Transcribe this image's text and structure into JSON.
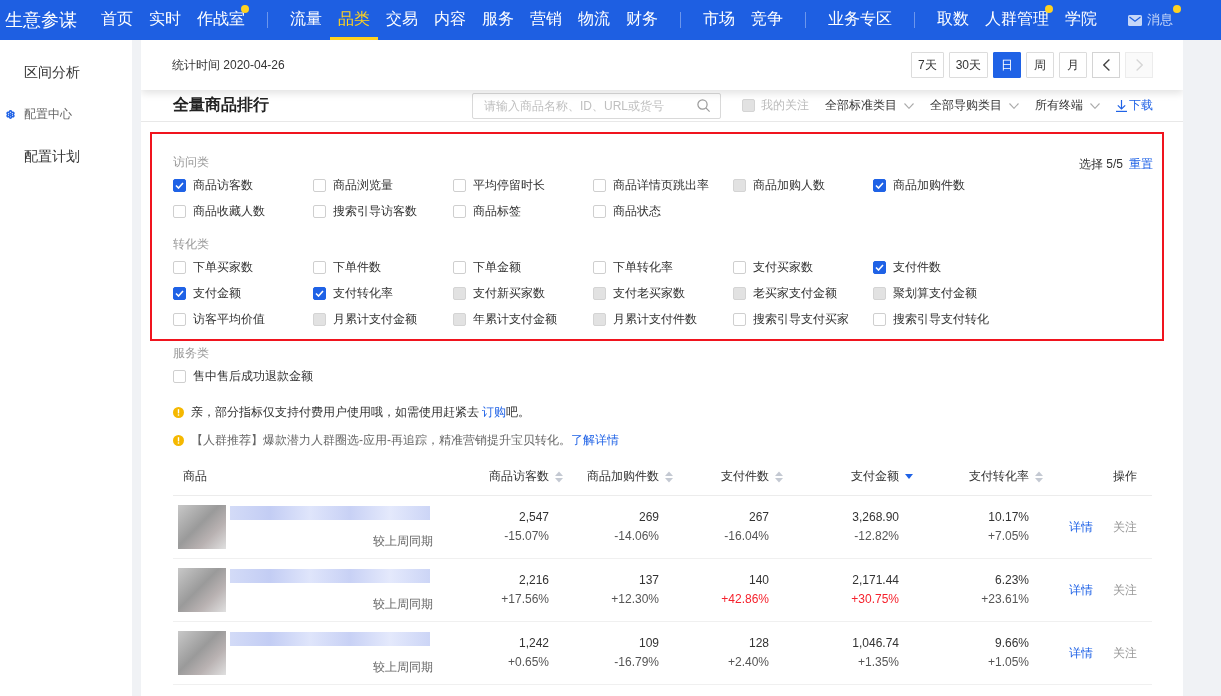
{
  "top_nav": {
    "brand": "生意参谋",
    "groups": [
      {
        "items": [
          {
            "label": "首页",
            "selected": false,
            "dot": false
          },
          {
            "label": "实时",
            "selected": false,
            "dot": false
          },
          {
            "label": "作战室",
            "selected": false,
            "dot": true
          }
        ]
      },
      {
        "items": [
          {
            "label": "流量",
            "selected": false,
            "dot": false
          },
          {
            "label": "品类",
            "selected": true,
            "dot": false
          },
          {
            "label": "交易",
            "selected": false,
            "dot": false
          },
          {
            "label": "内容",
            "selected": false,
            "dot": false
          },
          {
            "label": "服务",
            "selected": false,
            "dot": false
          },
          {
            "label": "营销",
            "selected": false,
            "dot": false
          },
          {
            "label": "物流",
            "selected": false,
            "dot": false
          },
          {
            "label": "财务",
            "selected": false,
            "dot": false
          }
        ]
      },
      {
        "items": [
          {
            "label": "市场",
            "selected": false,
            "dot": false
          },
          {
            "label": "竞争",
            "selected": false,
            "dot": false
          }
        ]
      },
      {
        "items": [
          {
            "label": "业务专区",
            "selected": false,
            "dot": false
          }
        ]
      },
      {
        "items": [
          {
            "label": "取数",
            "selected": false,
            "dot": false
          },
          {
            "label": "人群管理",
            "selected": false,
            "dot": true
          },
          {
            "label": "学院",
            "selected": false,
            "dot": false
          }
        ]
      }
    ],
    "messages": {
      "label": "消息",
      "dot": true
    }
  },
  "sidebar": {
    "items": [
      {
        "kind": "link",
        "label": "区间分析"
      },
      {
        "kind": "section",
        "label": "配置中心"
      },
      {
        "kind": "link",
        "label": "配置计划"
      }
    ]
  },
  "header": {
    "stat_time": "统计时间 2020-04-26",
    "periods": [
      {
        "label": "7天",
        "selected": false
      },
      {
        "label": "30天",
        "selected": false
      },
      {
        "label": "日",
        "selected": true
      },
      {
        "label": "周",
        "selected": false
      },
      {
        "label": "月",
        "selected": false
      }
    ],
    "nav_buttons": [
      {
        "kind": "prev",
        "disabled": false
      },
      {
        "kind": "next",
        "disabled": true
      }
    ]
  },
  "ranking": {
    "title": "全量商品排行",
    "search": {
      "placeholder": "请输入商品名称、ID、URL或货号"
    },
    "follow_filter": {
      "label": "我的关注",
      "checked": false,
      "disabled": true
    },
    "filters": [
      {
        "label": "全部标准类目"
      },
      {
        "label": "全部导购类目"
      },
      {
        "label": "所有终端"
      }
    ],
    "download": "下载"
  },
  "metrics": {
    "selection": "选择 5/5",
    "reset": "重置",
    "groups": [
      {
        "title": "访问类",
        "highlighted": true,
        "items": [
          {
            "label": "商品访客数",
            "checked": true,
            "disabled": false
          },
          {
            "label": "商品浏览量",
            "checked": false,
            "disabled": false
          },
          {
            "label": "平均停留时长",
            "checked": false,
            "disabled": false
          },
          {
            "label": "商品详情页跳出率",
            "checked": false,
            "disabled": false
          },
          {
            "label": "商品加购人数",
            "checked": false,
            "disabled": true
          },
          {
            "label": "商品加购件数",
            "checked": true,
            "disabled": false
          },
          {
            "label": "商品收藏人数",
            "checked": false,
            "disabled": false
          },
          {
            "label": "搜索引导访客数",
            "checked": false,
            "disabled": false
          },
          {
            "label": "商品标签",
            "checked": false,
            "disabled": false
          },
          {
            "label": "商品状态",
            "checked": false,
            "disabled": false
          }
        ]
      },
      {
        "title": "转化类",
        "highlighted": true,
        "items": [
          {
            "label": "下单买家数",
            "checked": false,
            "disabled": false
          },
          {
            "label": "下单件数",
            "checked": false,
            "disabled": false
          },
          {
            "label": "下单金额",
            "checked": false,
            "disabled": false
          },
          {
            "label": "下单转化率",
            "checked": false,
            "disabled": false
          },
          {
            "label": "支付买家数",
            "checked": false,
            "disabled": false
          },
          {
            "label": "支付件数",
            "checked": true,
            "disabled": false
          },
          {
            "label": "支付金额",
            "checked": true,
            "disabled": false
          },
          {
            "label": "支付转化率",
            "checked": true,
            "disabled": false
          },
          {
            "label": "支付新买家数",
            "checked": false,
            "disabled": true
          },
          {
            "label": "支付老买家数",
            "checked": false,
            "disabled": true
          },
          {
            "label": "老买家支付金额",
            "checked": false,
            "disabled": true
          },
          {
            "label": "聚划算支付金额",
            "checked": false,
            "disabled": true
          },
          {
            "label": "访客平均价值",
            "checked": false,
            "disabled": false
          },
          {
            "label": "月累计支付金额",
            "checked": false,
            "disabled": true
          },
          {
            "label": "年累计支付金额",
            "checked": false,
            "disabled": true
          },
          {
            "label": "月累计支付件数",
            "checked": false,
            "disabled": true
          },
          {
            "label": "搜索引导支付买家",
            "checked": false,
            "disabled": false
          },
          {
            "label": "搜索引导支付转化",
            "checked": false,
            "disabled": false
          }
        ]
      },
      {
        "title": "服务类",
        "highlighted": false,
        "items": [
          {
            "label": "售中售后成功退款金额",
            "checked": false,
            "disabled": false
          }
        ]
      }
    ]
  },
  "tips": [
    {
      "text": "亲，部分指标仅支持付费用户使用哦，如需使用赶紧去 ",
      "link": "订购",
      "suffix": "吧。",
      "muted": false
    },
    {
      "text": "【人群推荐】爆款潜力人群圈选-应用-再追踪，精准营销提升宝贝转化。",
      "link": "了解详情",
      "muted": true
    }
  ],
  "table": {
    "columns": [
      {
        "kind": "product",
        "label": "商品"
      },
      {
        "kind": "metric",
        "label": "商品访客数",
        "sorted": false
      },
      {
        "kind": "metric",
        "label": "商品加购件数",
        "sorted": false
      },
      {
        "kind": "metric",
        "label": "支付件数",
        "sorted": false
      },
      {
        "kind": "metric",
        "label": "支付金额",
        "sorted": true
      },
      {
        "kind": "metric",
        "label": "支付转化率",
        "sorted": false
      },
      {
        "kind": "actions",
        "label": "操作"
      }
    ],
    "rows": [
      {
        "cells": [
          {
            "kind": "product",
            "compare_label": "较上周同期"
          },
          {
            "kind": "metric",
            "value": "2,547",
            "change": "-15.07%",
            "highlighted": false
          },
          {
            "kind": "metric",
            "value": "269",
            "change": "-14.06%",
            "highlighted": false
          },
          {
            "kind": "metric",
            "value": "267",
            "change": "-16.04%",
            "highlighted": false
          },
          {
            "kind": "metric",
            "value": "3,268.90",
            "change": "-12.82%",
            "highlighted": false
          },
          {
            "kind": "metric",
            "value": "10.17%",
            "change": "+7.05%",
            "highlighted": false
          },
          {
            "kind": "actions",
            "links": [
              {
                "kind": "details",
                "label": "详情"
              },
              {
                "kind": "follow",
                "label": "关注"
              }
            ]
          }
        ]
      },
      {
        "cells": [
          {
            "kind": "product",
            "compare_label": "较上周同期"
          },
          {
            "kind": "metric",
            "value": "2,216",
            "change": "+17.56%",
            "highlighted": false
          },
          {
            "kind": "metric",
            "value": "137",
            "change": "+12.30%",
            "highlighted": false
          },
          {
            "kind": "metric",
            "value": "140",
            "change": "+42.86%",
            "highlighted": true
          },
          {
            "kind": "metric",
            "value": "2,171.44",
            "change": "+30.75%",
            "highlighted": true
          },
          {
            "kind": "metric",
            "value": "6.23%",
            "change": "+23.61%",
            "highlighted": false
          },
          {
            "kind": "actions",
            "links": [
              {
                "kind": "details",
                "label": "详情"
              },
              {
                "kind": "follow",
                "label": "关注"
              }
            ]
          }
        ]
      },
      {
        "cells": [
          {
            "kind": "product",
            "compare_label": "较上周同期"
          },
          {
            "kind": "metric",
            "value": "1,242",
            "change": "+0.65%",
            "highlighted": false
          },
          {
            "kind": "metric",
            "value": "109",
            "change": "-16.79%",
            "highlighted": false
          },
          {
            "kind": "metric",
            "value": "128",
            "change": "+2.40%",
            "highlighted": false
          },
          {
            "kind": "metric",
            "value": "1,046.74",
            "change": "+1.35%",
            "highlighted": false
          },
          {
            "kind": "metric",
            "value": "9.66%",
            "change": "+1.05%",
            "highlighted": false
          },
          {
            "kind": "actions",
            "links": [
              {
                "kind": "details",
                "label": "详情"
              },
              {
                "kind": "follow",
                "label": "关注"
              }
            ]
          }
        ]
      }
    ]
  }
}
